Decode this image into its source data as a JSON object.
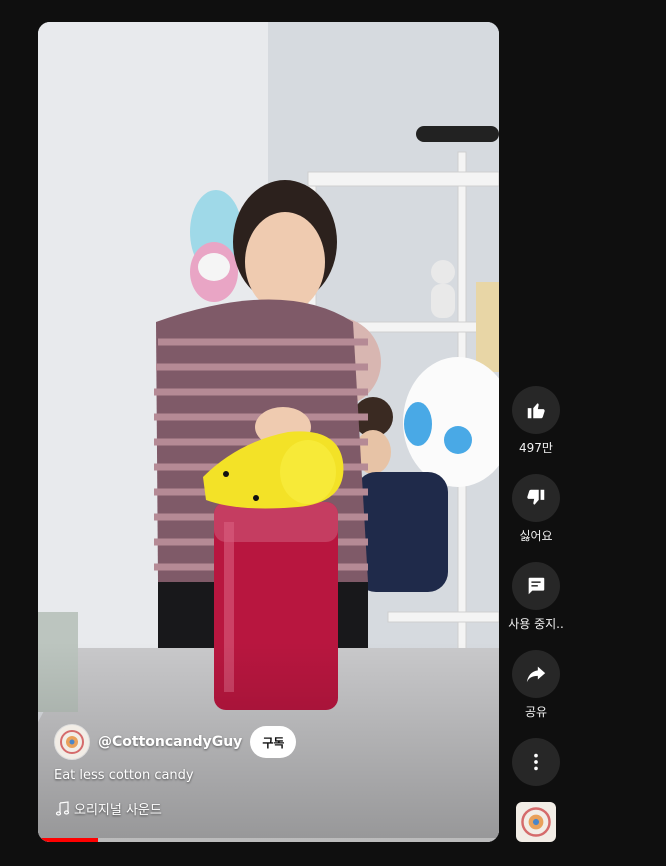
{
  "video": {
    "channel_handle": "@CottoncandyGuy",
    "subscribe_label": "구독",
    "title": "Eat less cotton candy",
    "sound_label": "오리지널 사운드",
    "progress_fraction": 0.13,
    "progress_color": "#ff0000"
  },
  "actions": {
    "like_count": "497만",
    "dislike_label": "싫어요",
    "comments_label": "사용 중지..",
    "share_label": "공유"
  },
  "icons": {
    "like": "thumb-up-icon",
    "dislike": "thumb-down-icon",
    "comments": "comment-icon",
    "share": "share-icon",
    "more": "more-vert-icon",
    "music": "music-note-icon"
  },
  "colors": {
    "background": "#0f0f0f",
    "action_button": "#272727",
    "subscribe_bg": "#ffffff"
  }
}
